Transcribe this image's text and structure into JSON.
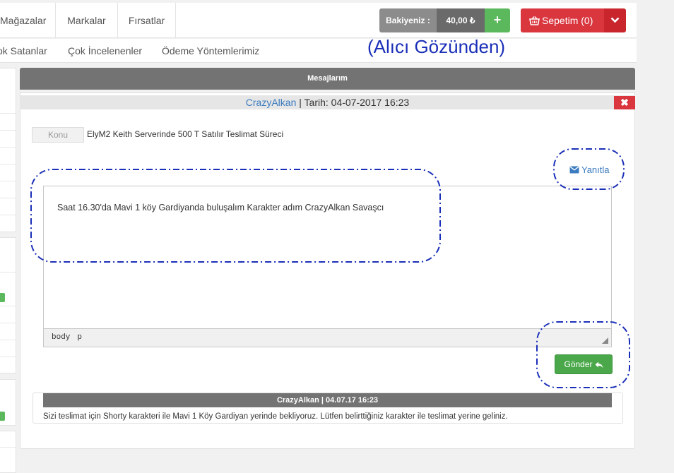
{
  "nav": {
    "items": [
      "Mağazalar",
      "Markalar",
      "Fırsatlar"
    ],
    "balance_label": "Bakiyeniz :",
    "balance_value": "40,00 ₺",
    "balance_add": "+",
    "cart_label": "Sepetim (0)"
  },
  "subnav": {
    "items": [
      "ok Satanlar",
      "Çok İncelenenler",
      "Ödeme Yöntemlerimiz"
    ]
  },
  "annotation": "(Alıcı Gözünden)",
  "panel": {
    "header": "Mesajlarım"
  },
  "message": {
    "sender": "CrazyAlkan",
    "date_text": " | Tarih: 04-07-2017 16:23",
    "close": "✖",
    "subject_label": "Konu",
    "subject": "ElyM2 Keith Serverinde 500 T Satılır Teslimat Süreci",
    "reply_label": "Yanıtla",
    "editor_text": "Saat 16.30'da Mavi 1 köy Gardiyanda buluşalım Karakter adım CrazyAlkan Savaşcı",
    "status_path": [
      "body",
      "p"
    ],
    "send_label": "Gönder"
  },
  "previous_reply": {
    "header": "CrazyAlkan | 04.07.17 16:23",
    "text": "Sizi teslimat için Shorty karakteri ile Mavi 1 Köy Gardiyan yerinde bekliyoruz. Lütfen belirttiğiniz karakter ile teslimat yerine geliniz."
  },
  "colors": {
    "annotation": "#1a2fb8",
    "danger": "#d9363e",
    "success": "#5cb85c",
    "link": "#3b7bbf"
  }
}
